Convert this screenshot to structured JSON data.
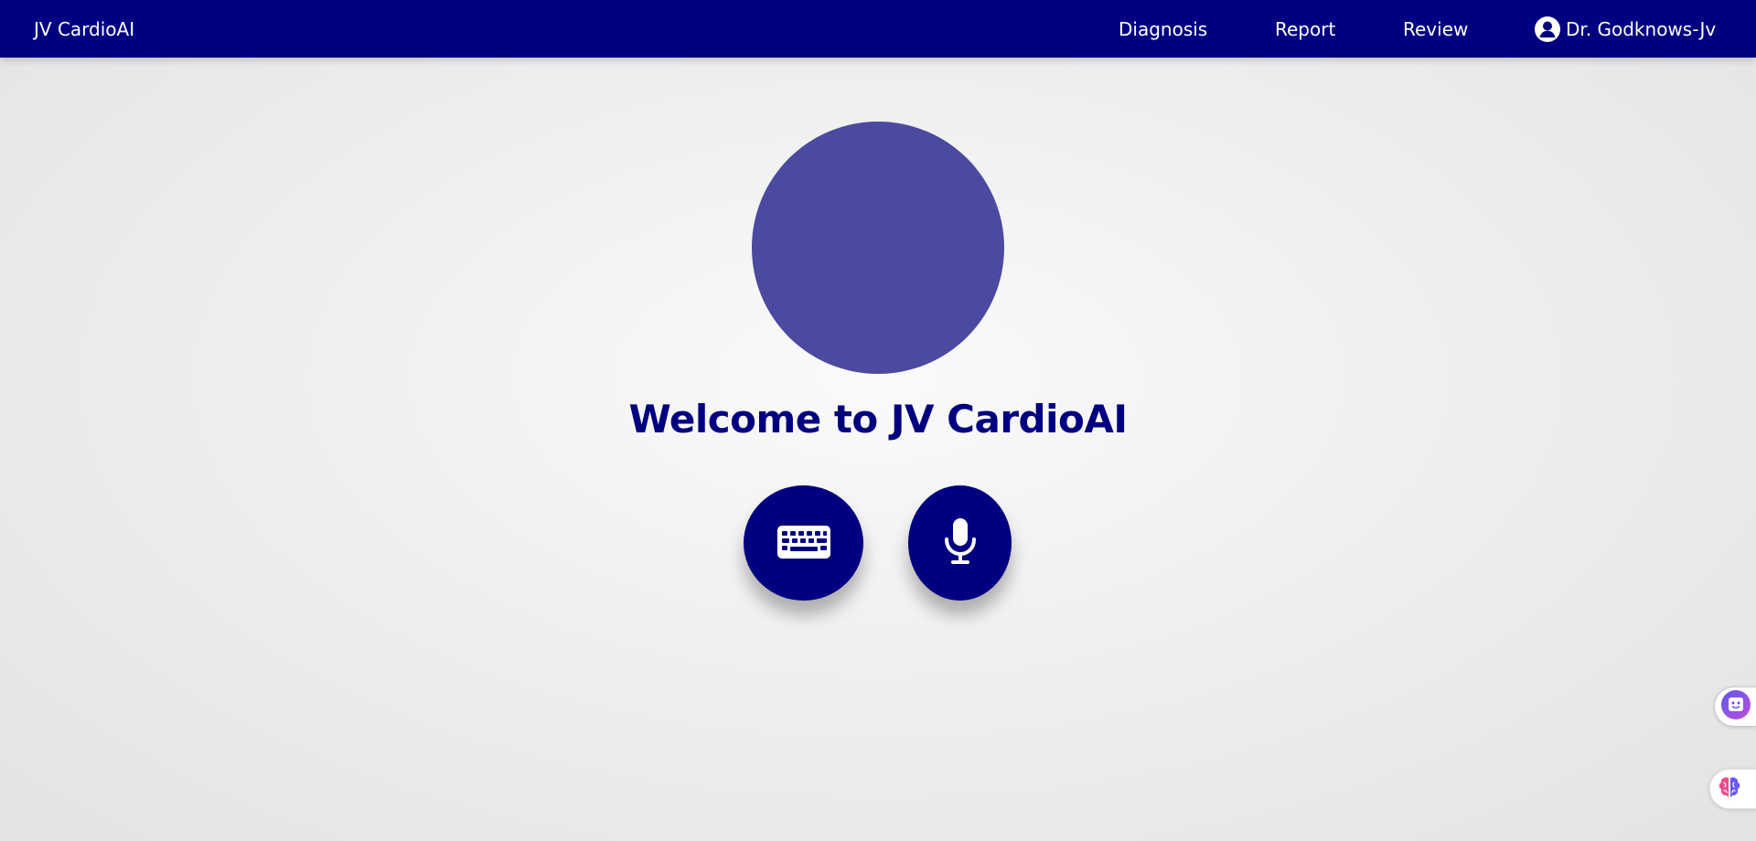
{
  "navbar": {
    "brand": "JV CardioAI",
    "links": [
      {
        "label": "Diagnosis"
      },
      {
        "label": "Report"
      },
      {
        "label": "Review"
      }
    ],
    "user": {
      "label": "Dr. Godknows-Jv",
      "icon": "user-circle-icon"
    }
  },
  "main": {
    "welcome_title": "Welcome to JV CardioAI",
    "buttons": [
      {
        "icon": "keyboard-icon"
      },
      {
        "icon": "microphone-icon"
      }
    ]
  },
  "widgets": {
    "chat": {
      "icon": "chatbot-face-icon"
    },
    "brain": {
      "icon": "brain-icon"
    }
  },
  "colors": {
    "primary": "#000080",
    "avatar": "#4a4aa0",
    "background": "#efefef",
    "text_on_primary": "#ffffff"
  }
}
